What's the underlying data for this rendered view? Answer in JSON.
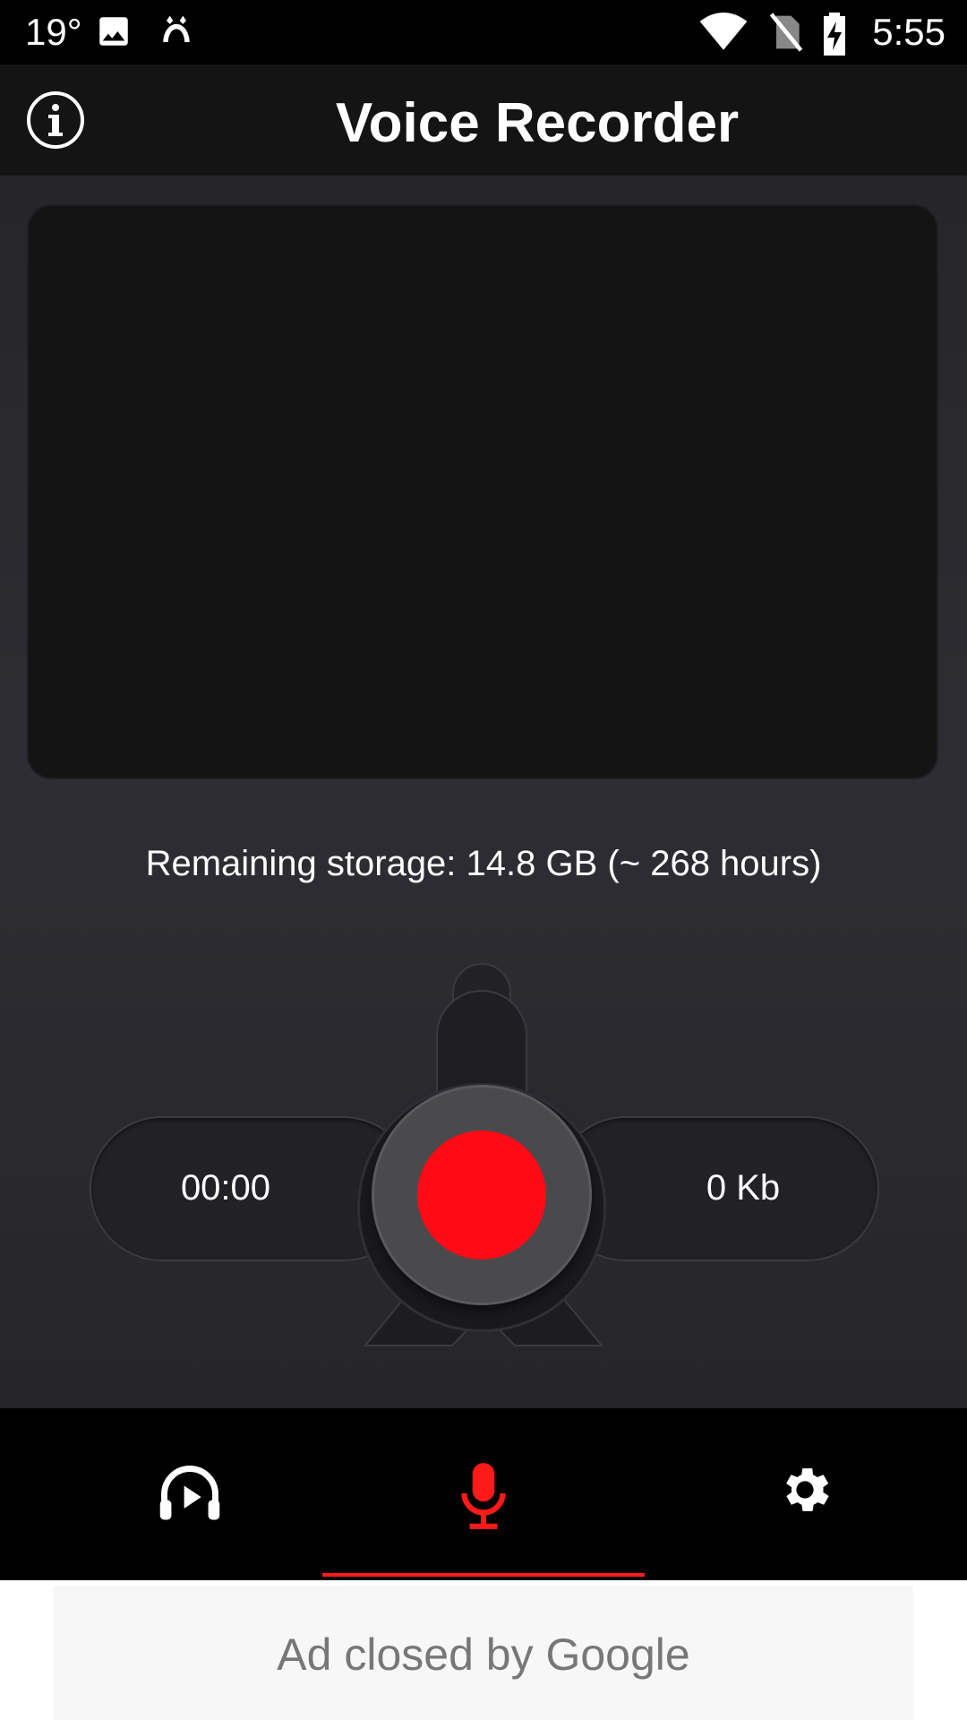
{
  "status_bar": {
    "temperature": "19°",
    "time": "5:55",
    "icons": [
      "image-icon",
      "notification-app-icon",
      "wifi-icon",
      "no-sim-icon",
      "battery-charging-icon"
    ]
  },
  "app_bar": {
    "title": "Voice Recorder",
    "info_icon": "info-icon"
  },
  "main": {
    "storage_text": "Remaining storage: 14.8 GB (~ 268 hours)",
    "timer": "00:00",
    "file_size": "0 Kb",
    "record_color": "#ff0a16"
  },
  "bottom_nav": {
    "items": [
      {
        "name": "player",
        "icon": "headphones-play-icon",
        "active": false
      },
      {
        "name": "recorder",
        "icon": "microphone-icon",
        "active": true
      },
      {
        "name": "settings",
        "icon": "gear-icon",
        "active": false
      }
    ],
    "accent": "#ff1a1a"
  },
  "ad": {
    "text": "Ad closed by Google"
  }
}
